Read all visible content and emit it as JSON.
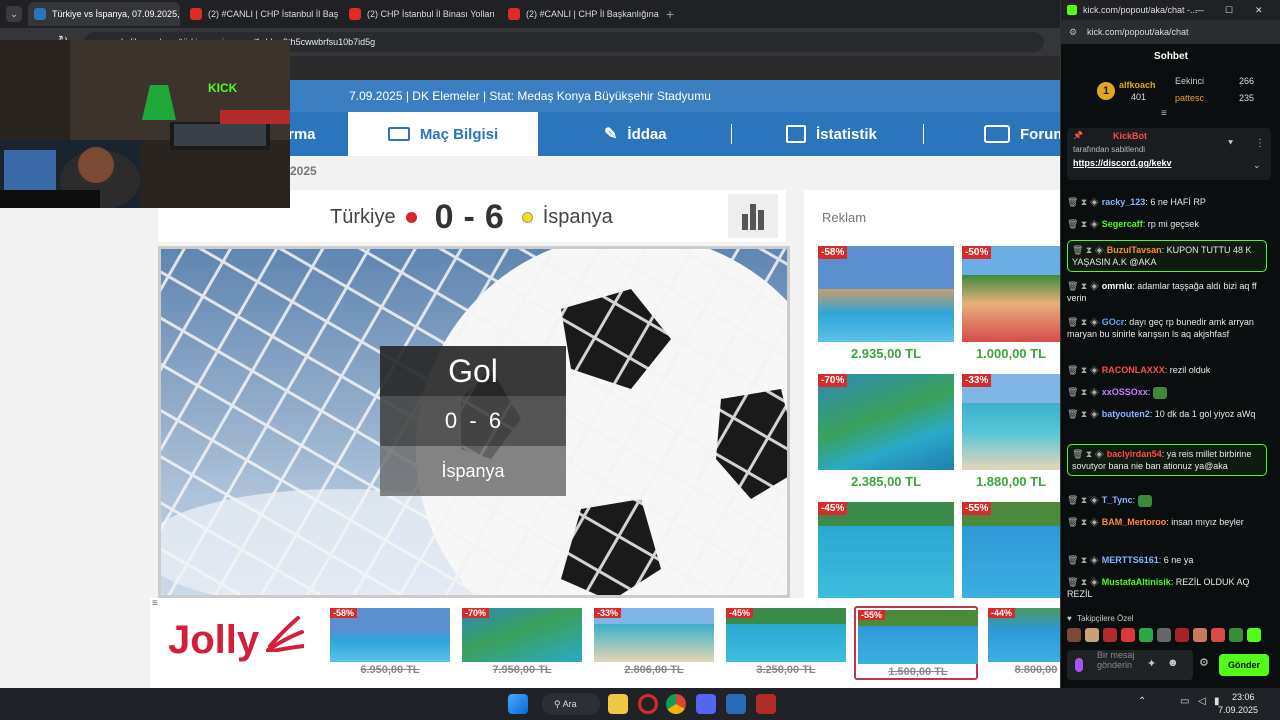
{
  "browser": {
    "tabs": [
      {
        "title": "Türkiye vs İspanya, 07.09.2025,",
        "active": true
      },
      {
        "title": "(2) #CANLI | CHP İstanbul İl Baş",
        "active": false
      },
      {
        "title": "(2) CHP İstanbul İl Binası Yolları",
        "active": false
      },
      {
        "title": "(2) #CANLI | CHP İl Başkanlığına",
        "active": false
      }
    ],
    "url": "mackolik.com/mac/türkiye-vs-ispanya/1gbbm9th5cwwbrfsu10b7id5g"
  },
  "match": {
    "info": "7.09.2025 | DK Elemeler | Stat: Medaş Konya Büyükşehir Stadyumu",
    "date_fragment": "9.2025",
    "home": "Türkiye",
    "away": "İspanya",
    "home_score": "0",
    "away_score": "6",
    "dash": "-",
    "home_color": "#d7262d",
    "away_color": "#f4e20f"
  },
  "nav": {
    "items": [
      "rma",
      "Maç Bilgisi",
      "İddaa",
      "İstatistik",
      "Forum"
    ],
    "active": "Maç Bilgisi"
  },
  "goal": {
    "title": "Gol",
    "score": "0  -  6",
    "team": "İspanya"
  },
  "ads": {
    "header": "Reklam",
    "cards": [
      {
        "badge": "-58%",
        "price": "2.935,00 TL"
      },
      {
        "badge": "-50%",
        "price": "1.000,00 TL"
      },
      {
        "badge": "-70%",
        "price": "2.385,00 TL"
      },
      {
        "badge": "-33%",
        "price": "1.880,00 TL"
      },
      {
        "badge": "-45%",
        "price": ""
      },
      {
        "badge": "-55%",
        "price": ""
      }
    ],
    "bottom_brand": "Jolly",
    "bottom_cards": [
      {
        "badge": "-58%",
        "price": "6.950,00 TL"
      },
      {
        "badge": "-70%",
        "price": "7.950,00 TL"
      },
      {
        "badge": "-33%",
        "price": "2.806,00 TL"
      },
      {
        "badge": "-45%",
        "price": "3.250,00 TL"
      },
      {
        "badge": "-55%",
        "price": "1.500,00 TL"
      },
      {
        "badge": "-44%",
        "price": "8.800,00"
      }
    ],
    "brand_color": "#d31f3a",
    "price_color": "#3aa83a"
  },
  "chat": {
    "window_title": "kick.com/popout/aka/chat -...",
    "url": "kick.com/popout/aka/chat",
    "header": "Sohbet",
    "leaders": [
      {
        "rank": "1",
        "name": "alfkoach",
        "count": "401"
      },
      {
        "name": "Eekinci",
        "count": "266"
      },
      {
        "name": "pattesc",
        "count": "235"
      }
    ],
    "pinned": {
      "user": "KickBot",
      "by": "tarafından sabitlendi",
      "link": "https://discord.gg/kekv"
    },
    "messages": [
      {
        "user": "racky_123",
        "color": "#8ab4ff",
        "text": "6 ne HAFİ RP",
        "hl": false
      },
      {
        "user": "Segercaff",
        "color": "#53fc18",
        "text": "rp mi geçsek",
        "hl": false
      },
      {
        "user": "BuzulTavsan",
        "color": "#ff8a3d",
        "text": "KUPON TUTTU 48 K YAŞASIN A.K @AKA",
        "hl": true
      },
      {
        "user": "omrnlu",
        "color": "#ffffff",
        "text": "adamlar taşşağa aldı bizi aq ff verin",
        "hl": false
      },
      {
        "user": "GOcr",
        "color": "#5aa6ff",
        "text": "dayı geç rp bunedir amk arryan maryan bu sinirle karışsın ls aq akjshfasf",
        "hl": false
      },
      {
        "user": "RACONLAXXX",
        "color": "#ff4b4b",
        "text": "rezil olduk",
        "hl": false
      },
      {
        "user": "xxOSSOxx",
        "color": "#c77dff",
        "text": "",
        "hl": false
      },
      {
        "user": "batyouten2",
        "color": "#8ab4ff",
        "text": "10 dk da 1 gol yiyoz aWq",
        "hl": false
      },
      {
        "user": "bacIyirdan54",
        "color": "#ff4b4b",
        "text": "ya reis millet birbirine sovutyor bana nie ban ationuz ya@aka",
        "hl": true
      },
      {
        "user": "T_Tync",
        "color": "#8ab4ff",
        "text": "",
        "hl": false
      },
      {
        "user": "BAM_Mertoroo",
        "color": "#ff8a3d",
        "text": "insan mıyız beyler",
        "hl": false
      },
      {
        "user": "MERTTS6161",
        "color": "#8ab4ff",
        "text": "6 ne ya",
        "hl": false
      },
      {
        "user": "MustafaAltinisik",
        "color": "#53fc18",
        "text": "REZİL OLDUK AQ REZİL",
        "hl": false
      }
    ],
    "followers_label": "Takipçilere Özel",
    "input_placeholder": "Bir mesaj gönderin",
    "send_label": "Gönder",
    "accent": "#53fc18"
  },
  "taskbar": {
    "search_label": "Ara",
    "time": "23:06",
    "date": "7.09.2025"
  }
}
